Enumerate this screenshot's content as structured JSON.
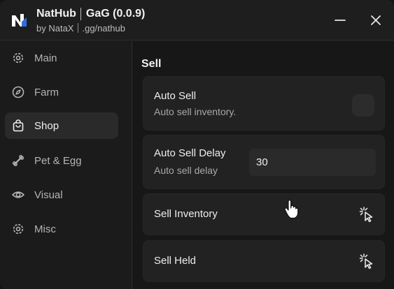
{
  "app": {
    "name": "NatHub",
    "game": "GaG (0.0.9)",
    "author": "by NataX",
    "invite": ".gg/nathub",
    "logo_icon": "nathub-logo-icon",
    "accent": "#2f6fe0"
  },
  "window_controls": {
    "minimize_icon": "minimize-icon",
    "close_icon": "close-icon"
  },
  "sidebar": {
    "active": "Shop",
    "items": [
      {
        "label": "Main",
        "icon": "gear-icon"
      },
      {
        "label": "Farm",
        "icon": "compass-icon"
      },
      {
        "label": "Shop",
        "icon": "shopping-bag-icon"
      },
      {
        "label": "Pet & Egg",
        "icon": "bone-icon"
      },
      {
        "label": "Visual",
        "icon": "eye-icon"
      },
      {
        "label": "Misc",
        "icon": "gear-icon"
      }
    ]
  },
  "main": {
    "section_title": "Sell",
    "auto_sell": {
      "title": "Auto Sell",
      "description": "Auto sell inventory.",
      "enabled": false
    },
    "auto_sell_delay": {
      "title": "Auto Sell Delay",
      "description": "Auto sell delay",
      "value": "30"
    },
    "sell_inventory": {
      "title": "Sell Inventory",
      "icon": "tap-icon"
    },
    "sell_held": {
      "title": "Sell Held",
      "icon": "tap-icon"
    }
  }
}
